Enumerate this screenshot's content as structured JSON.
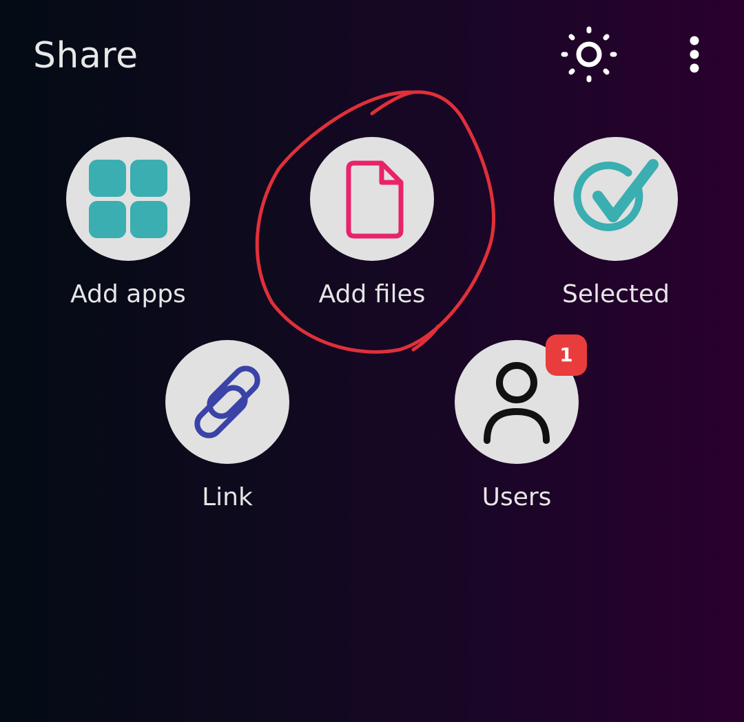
{
  "header": {
    "title": "Share",
    "brightness_icon": "brightness-icon",
    "more_icon": "more-vertical-icon"
  },
  "tiles": [
    {
      "label": "Add apps",
      "icon": "apps-grid-icon"
    },
    {
      "label": "Add files",
      "icon": "file-icon"
    },
    {
      "label": "Selected",
      "icon": "check-circle-icon"
    },
    {
      "label": "Link",
      "icon": "link-icon"
    },
    {
      "label": "Users",
      "icon": "user-icon",
      "badge": "1"
    }
  ],
  "colors": {
    "background_start": "#030b14",
    "background_end": "#2a002e",
    "circle": "#e1e1e1",
    "apps_icon": "#3aaeb0",
    "file_icon": "#e8236a",
    "check_icon": "#3aaeb0",
    "link_icon": "#3a43a8",
    "user_icon": "#111111",
    "badge": "#e93c3c",
    "annotation": "#e0303a"
  }
}
